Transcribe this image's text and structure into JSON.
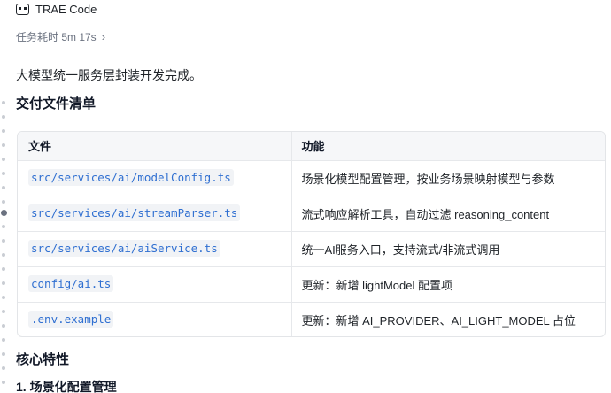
{
  "app": {
    "title": "TRAE Code",
    "icon": "trae-icon"
  },
  "task": {
    "elapsed_label": "任务耗时 5m 17s"
  },
  "content": {
    "summary": "大模型统一服务层封装开发完成。",
    "files_heading": "交付文件清单",
    "table": {
      "headers": [
        "文件",
        "功能"
      ],
      "rows": [
        {
          "file": "src/services/ai/modelConfig.ts",
          "desc": "场景化模型配置管理，按业务场景映射模型与参数"
        },
        {
          "file": "src/services/ai/streamParser.ts",
          "desc": "流式响应解析工具，自动过滤 reasoning_content"
        },
        {
          "file": "src/services/ai/aiService.ts",
          "desc": "统一AI服务入口，支持流式/非流式调用"
        },
        {
          "file": "config/ai.ts",
          "desc": "更新：新增 lightModel 配置项"
        },
        {
          "file": ".env.example",
          "desc": "更新：新增 AI_PROVIDER、AI_LIGHT_MODEL 占位"
        }
      ]
    },
    "features_heading": "核心特性",
    "sub_heading": "1. 场景化配置管理"
  }
}
